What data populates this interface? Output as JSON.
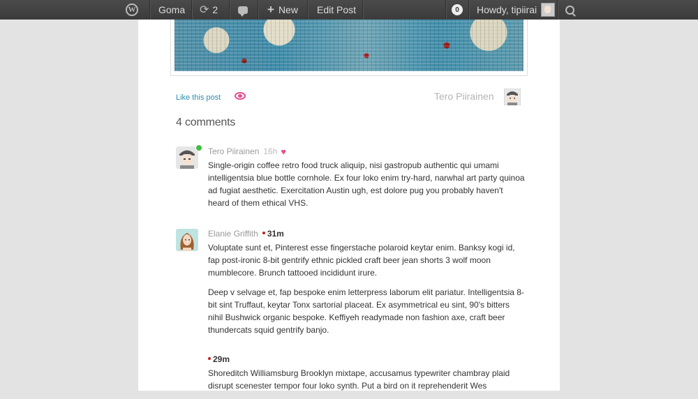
{
  "adminbar": {
    "site_name": "Goma",
    "updates_count": "2",
    "new_label": "New",
    "edit_label": "Edit Post",
    "notifications_count": "0",
    "howdy": "Howdy, tipiirai"
  },
  "post": {
    "like_link": "Like this post",
    "author": "Tero Piirainen"
  },
  "comments": {
    "title": "4 comments",
    "items": [
      {
        "author": "Tero Piirainen",
        "time": "16h",
        "paragraphs": [
          "Single-origin coffee retro food truck aliquip, nisi gastropub authentic qui umami intelligentsia blue bottle cornhole. Ex four loko enim try-hard, narwhal art party quinoa ad fugiat aesthetic. Exercitation Austin ugh, est dolore pug you probably haven't heard of them ethical VHS."
        ]
      },
      {
        "author": "Elanie Griffith",
        "time": "31m",
        "paragraphs": [
          "Voluptate sunt et, Pinterest esse fingerstache polaroid keytar enim. Banksy kogi id, fap post-ironic 8-bit gentrify ethnic pickled craft beer jean shorts 3 wolf moon mumblecore. Brunch tattooed incididunt irure.",
          "Deep v selvage et, fap bespoke enim letterpress laborum elit pariatur. Intelligentsia 8-bit sint Truffaut, keytar Tonx sartorial placeat. Ex asymmetrical eu sint, 90's bitters nihil Bushwick organic bespoke. Keffiyeh readymade non fashion axe, craft beer thundercats squid gentrify banjo."
        ]
      },
      {
        "author": "",
        "time": "29m",
        "paragraphs": [
          "Shoreditch Williamsburg Brooklyn mixtape, accusamus typewriter chambray plaid disrupt scenester tempor four loko synth. Put a bird on it reprehenderit Wes"
        ]
      }
    ]
  }
}
